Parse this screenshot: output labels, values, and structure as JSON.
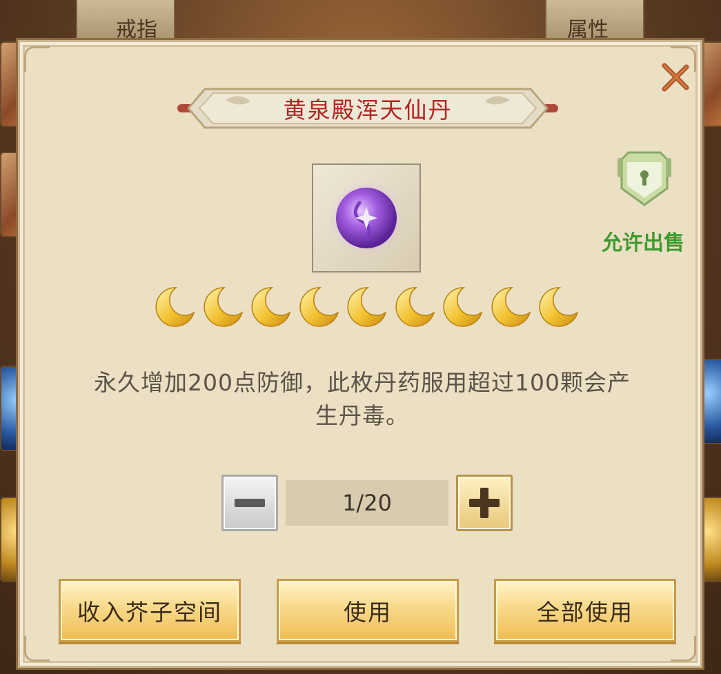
{
  "background": {
    "tabs": [
      {
        "label": "戒指"
      },
      {
        "label": "属性"
      }
    ]
  },
  "dialog": {
    "title": "黄泉殿浑天仙丹",
    "item_icon": "purple-pill-icon",
    "sell_status": "允许出售",
    "rarity_moons": 9,
    "description_line1": "永久增加200点防御，此枚丹药服用超过100颗会产",
    "description_line2": "生丹毒。",
    "quantity": "1/20",
    "quantity_value": 1,
    "quantity_max": 20,
    "buttons": {
      "store": "收入芥子空间",
      "use": "使用",
      "use_all": "全部使用"
    }
  },
  "colors": {
    "title": "#b42323",
    "sell_status": "#3f9a2e",
    "description": "#5c5248",
    "panel": "#ebdfc4",
    "button_gold": "#f8d98a"
  }
}
